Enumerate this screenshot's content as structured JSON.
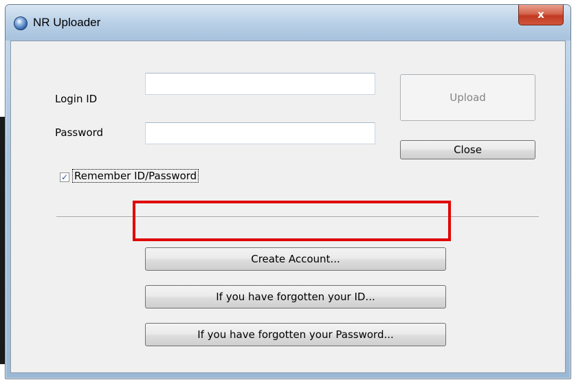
{
  "window": {
    "title": "NR Uploader",
    "close_glyph": "x"
  },
  "form": {
    "login_label": "Login ID",
    "login_value": "",
    "password_label": "Password",
    "password_value": "",
    "remember_label": "Remember ID/Password",
    "remember_checked": true,
    "checkmark": "✓"
  },
  "buttons": {
    "upload": "Upload",
    "close": "Close",
    "create_account": "Create Account...",
    "forgot_id": "If you have forgotten your ID...",
    "forgot_password": "If you have forgotten your Password..."
  },
  "colors": {
    "highlight": "#e00000"
  }
}
